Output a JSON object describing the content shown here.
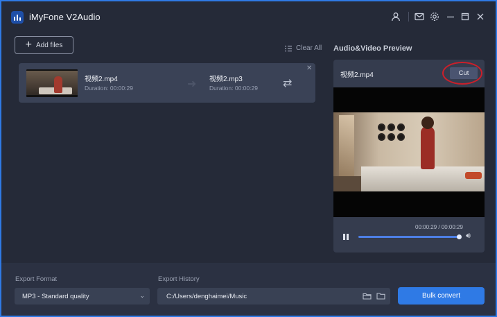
{
  "app": {
    "title": "iMyFone V2Audio",
    "icons": [
      "user-icon",
      "mail-icon",
      "settings-icon",
      "minimize-icon",
      "maximize-icon",
      "close-icon"
    ]
  },
  "toolbar": {
    "add_files_label": "Add files",
    "clear_all_label": "Clear All"
  },
  "files": [
    {
      "source_name": "视频2.mp4",
      "source_duration": "Duration: 00:00:29",
      "target_name": "视频2.mp3",
      "target_duration": "Duration: 00:00:29"
    }
  ],
  "preview": {
    "section_title": "Audio&Video Preview",
    "file_name": "视频2.mp4",
    "cut_label": "Cut",
    "time": "00:00:29 / 00:00:29",
    "progress": 1.0,
    "highlight_color": "#cc1f2a"
  },
  "bottom": {
    "export_format_label": "Export Format",
    "export_format_value": "MP3 - Standard quality",
    "export_history_label": "Export History",
    "export_history_value": "C:/Users/denghaimei/Music",
    "bulk_convert_label": "Bulk convert"
  },
  "colors": {
    "accent": "#2f7ae5",
    "background": "#252a38",
    "panel": "#353c4e"
  }
}
